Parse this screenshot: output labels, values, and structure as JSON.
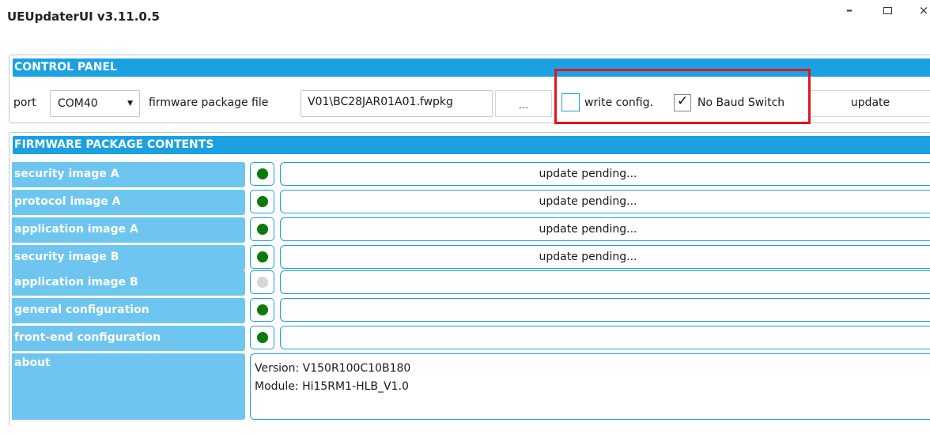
{
  "window": {
    "title": "UEUpdaterUI v3.11.0.5",
    "minimize": "–",
    "close": "×"
  },
  "control_panel": {
    "header": "CONTROL PANEL",
    "port_label": "port",
    "port_value": "COM40",
    "firmware_label": "firmware package file",
    "firmware_value": "V01\\BC28JAR01A01.fwpkg",
    "browse_label": "...",
    "write_config_label": "write config.",
    "write_config_checked": false,
    "no_baud_switch_label": "No Baud Switch",
    "no_baud_switch_checked": true,
    "update_label": "update",
    "highlight_color": "#e5131d"
  },
  "firmware": {
    "header": "FIRMWARE PACKAGE CONTENTS",
    "rows": [
      {
        "label": "security image A",
        "status": "green",
        "progress": "update pending..."
      },
      {
        "label": "protocol image A",
        "status": "green",
        "progress": "update pending..."
      },
      {
        "label": "application image A",
        "status": "green",
        "progress": "update pending..."
      },
      {
        "label": "security image B",
        "status": "green",
        "progress": "update pending..."
      },
      {
        "label": "application image B",
        "status": "gray",
        "progress": ""
      },
      {
        "label": "general configuration",
        "status": "green",
        "progress": ""
      },
      {
        "label": "front-end configuration",
        "status": "green",
        "progress": ""
      }
    ],
    "about": {
      "label": "about",
      "version": "Version: V150R100C10B180",
      "module": "Module: Hi15RM1-HLB_V1.0"
    }
  },
  "colors": {
    "accent": "#1ba1e2",
    "row_label_bg": "#6ec6f0",
    "status_green": "#0a7a0a",
    "status_gray": "#d6d6d6"
  }
}
